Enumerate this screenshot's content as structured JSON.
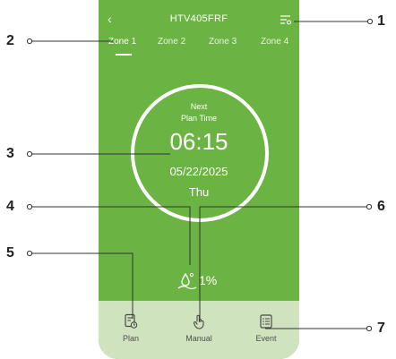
{
  "header": {
    "back_icon": "chevron-left-icon",
    "title": "HTV405FRF",
    "menu_icon": "list-settings-icon"
  },
  "tabs": [
    {
      "label": "Zone 1",
      "active": true
    },
    {
      "label": "Zone 2",
      "active": false
    },
    {
      "label": "Zone 3",
      "active": false
    },
    {
      "label": "Zone 4",
      "active": false
    }
  ],
  "plan": {
    "next_line1": "Next",
    "next_line2": "Plan Time",
    "time": "06:15",
    "date": "05/22/2025",
    "day": "Thu"
  },
  "humidity": {
    "icon": "soil-moisture-icon",
    "value": "1%"
  },
  "bottom_nav": [
    {
      "label": "Plan",
      "icon": "plan-document-icon"
    },
    {
      "label": "Manual",
      "icon": "hand-tap-icon"
    },
    {
      "label": "Event",
      "icon": "event-list-icon"
    }
  ],
  "annotations": [
    "1",
    "2",
    "3",
    "4",
    "5",
    "6",
    "7"
  ],
  "colors": {
    "primary_green": "#6bb443",
    "bottom_bar": "#cfe3be",
    "annotation_line": "#222222"
  }
}
